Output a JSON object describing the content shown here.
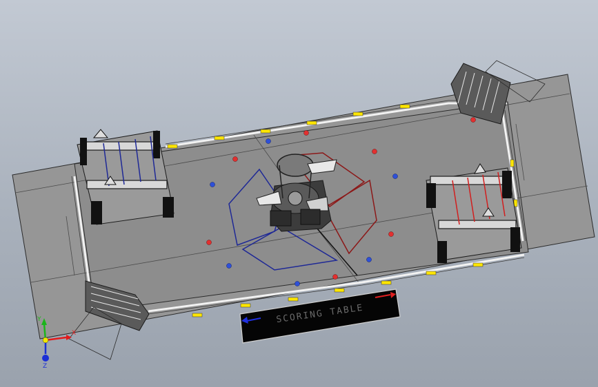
{
  "scene": {
    "scoring_table_label": "SCORING TABLE",
    "colors": {
      "field_floor": "#8d8d8d",
      "field_outline": "#1e1e1e",
      "red_alliance": "#d21e1e",
      "blue_alliance": "#1e2896",
      "yellow_marker": "#ffe600",
      "table_black": "#050505"
    },
    "balls": {
      "red": 7,
      "blue": 7
    },
    "icons": [
      "triad-icon"
    ]
  },
  "triad": {
    "x_label": "X",
    "y_label": "Y",
    "z_label": "Z",
    "x_color": "#e21b1b",
    "y_color": "#1bb51b",
    "z_color": "#1b2fd6"
  }
}
